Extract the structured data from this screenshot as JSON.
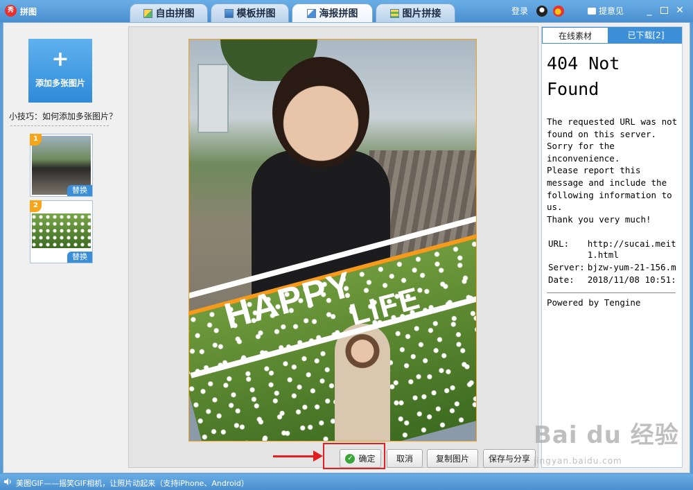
{
  "app": {
    "title": "拼图",
    "logo_text": "秀"
  },
  "tabs": [
    {
      "label": "自由拼图"
    },
    {
      "label": "模板拼图"
    },
    {
      "label": "海报拼图",
      "active": true
    },
    {
      "label": "图片拼接"
    }
  ],
  "titlebar": {
    "login": "登录",
    "feedback": "提意见"
  },
  "sidebar": {
    "add_label": "添加多张图片",
    "tip": "小技巧：如何添加多张图片？",
    "thumbs": [
      {
        "num": "1",
        "replace": "替换"
      },
      {
        "num": "2",
        "replace": "替换"
      }
    ]
  },
  "poster": {
    "line1": "HAPPY",
    "line2": "LIFE"
  },
  "actions": {
    "confirm": "确定",
    "cancel": "取消",
    "copy": "复制图片",
    "save_share": "保存与分享"
  },
  "right_panel": {
    "tabs": [
      {
        "label": "在线素材",
        "active": true
      },
      {
        "label": "已下载[2]"
      }
    ],
    "error": {
      "title": "404 Not Found",
      "body": "The requested URL was not found on this server. Sorry for the inconvenience.\nPlease report this message and include the following information to us.\nThank you very much!",
      "rows": [
        {
          "key": "URL:",
          "value": "http://sucai.meit\n1.html"
        },
        {
          "key": "Server:",
          "value": "bjzw-yum-21-156.m"
        },
        {
          "key": "Date:",
          "value": "2018/11/08 10:51:"
        }
      ],
      "powered": "Powered by Tengine"
    }
  },
  "watermark": {
    "main": "Bai du 经验",
    "sub": "jingyan.baidu.com"
  },
  "status": {
    "text": "美图GIF——摇笑GIF相机，让照片动起来（支持iPhone、Android）"
  },
  "colors": {
    "accent": "#3d8fd8",
    "highlight": "#e02020",
    "poster_stripe": "#f59a1b"
  }
}
